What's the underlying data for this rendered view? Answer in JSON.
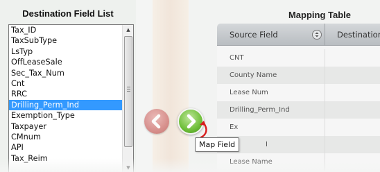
{
  "left_panel": {
    "title": "Destination Field List",
    "items": [
      "Tax_ID",
      "TaxSubType",
      "LsTyp",
      "OffLeaseSale",
      "Sec_Tax_Num",
      "Cnt",
      "RRC",
      "Drilling_Perm_Ind",
      "Exemption_Type",
      "Taxpayer",
      "CMnum",
      "API",
      "Tax_Reim"
    ],
    "selected_item": "Drilling_Perm_Ind"
  },
  "right_panel": {
    "title": "Mapping Table",
    "columns": [
      "Source Field",
      "Destination"
    ],
    "rows": [
      "CNT",
      "County Name",
      "Lease Num",
      "Drilling_Perm_Ind",
      "Ex",
      "I",
      "Lease Name"
    ]
  },
  "tooltip": "Map Field",
  "icons": {
    "unmap": "chevron-left-icon",
    "map": "chevron-right-icon",
    "sort": "sort-icon",
    "cursor": "curved-arrow-icon"
  },
  "colors": {
    "selection": "#3399ff",
    "map_button": "#6fbf3a",
    "unmap_button": "#d17d7a"
  }
}
